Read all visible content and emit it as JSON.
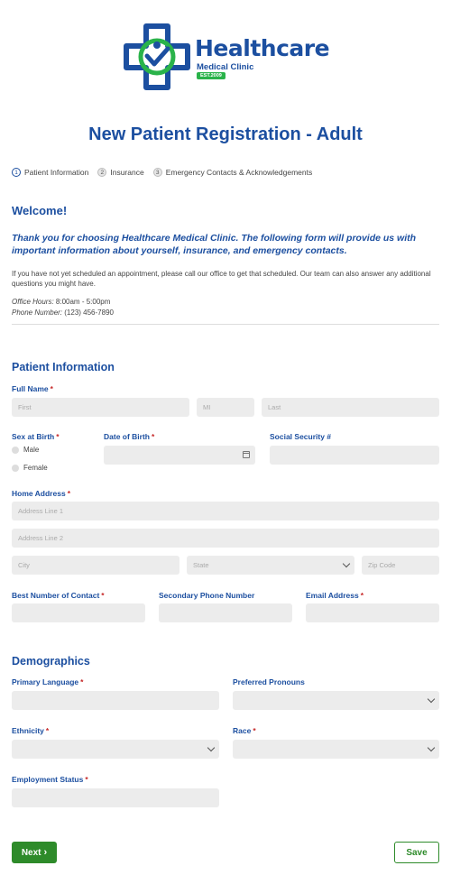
{
  "logo": {
    "name": "Healthcare",
    "subtitle": "Medical Clinic",
    "est": "EST.2009"
  },
  "title": "New Patient Registration - Adult",
  "steps": [
    {
      "num": "1",
      "label": "Patient Information"
    },
    {
      "num": "2",
      "label": "Insurance"
    },
    {
      "num": "3",
      "label": "Emergency Contacts & Acknowledgements"
    }
  ],
  "welcome": {
    "heading": "Welcome!",
    "thanks": "Thank you for choosing Healthcare Medical Clinic.  The following form will provide us with important information about yourself, insurance, and emergency contacts.",
    "info": "If you have not yet scheduled an appointment, please call our office to get that scheduled. Our team can also answer any additional questions you might have.",
    "hours_label": "Office Hours:",
    "hours_value": " 8:00am - 5:00pm",
    "phone_label": "Phone Number:",
    "phone_value": " (123) 456-7890"
  },
  "patient": {
    "heading": "Patient Information",
    "full_name": {
      "label": "Full Name",
      "first": "First",
      "mi": "MI",
      "last": "Last"
    },
    "sex": {
      "label": "Sex at Birth",
      "options": [
        "Male",
        "Female"
      ]
    },
    "dob": {
      "label": "Date of Birth"
    },
    "ssn": {
      "label": "Social Security #"
    },
    "address": {
      "label": "Home Address",
      "line1": "Address Line 1",
      "line2": "Address Line 2",
      "city": "City",
      "state": "State",
      "zip": "Zip Code"
    },
    "best_contact": {
      "label": "Best Number of Contact"
    },
    "secondary_phone": {
      "label": "Secondary Phone Number"
    },
    "email": {
      "label": "Email Address"
    }
  },
  "demographics": {
    "heading": "Demographics",
    "primary_language": "Primary Language",
    "pronouns": "Preferred Pronouns",
    "ethnicity": "Ethnicity",
    "race": "Race",
    "employment": "Employment Status"
  },
  "buttons": {
    "next": "Next",
    "save": "Save"
  },
  "colors": {
    "brand_blue": "#1c4fa0",
    "brand_green": "#2ab34a",
    "required": "#c62828",
    "button_green": "#2e8b2a"
  }
}
